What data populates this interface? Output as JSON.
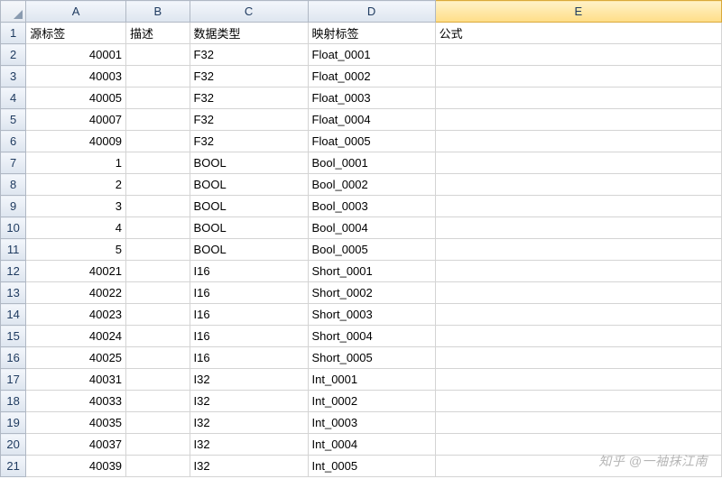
{
  "columns": [
    "A",
    "B",
    "C",
    "D",
    "E"
  ],
  "selected_column": "E",
  "headers": {
    "A": "源标签",
    "B": "描述",
    "C": "数据类型",
    "D": "映射标签",
    "E": "公式"
  },
  "rows": [
    {
      "n": 1,
      "A": "源标签",
      "B": "描述",
      "C": "数据类型",
      "D": "映射标签",
      "E": "公式"
    },
    {
      "n": 2,
      "A": "40001",
      "B": "",
      "C": "F32",
      "D": "Float_0001",
      "E": ""
    },
    {
      "n": 3,
      "A": "40003",
      "B": "",
      "C": "F32",
      "D": "Float_0002",
      "E": ""
    },
    {
      "n": 4,
      "A": "40005",
      "B": "",
      "C": "F32",
      "D": "Float_0003",
      "E": ""
    },
    {
      "n": 5,
      "A": "40007",
      "B": "",
      "C": "F32",
      "D": "Float_0004",
      "E": ""
    },
    {
      "n": 6,
      "A": "40009",
      "B": "",
      "C": "F32",
      "D": "Float_0005",
      "E": ""
    },
    {
      "n": 7,
      "A": "1",
      "B": "",
      "C": "BOOL",
      "D": "Bool_0001",
      "E": ""
    },
    {
      "n": 8,
      "A": "2",
      "B": "",
      "C": "BOOL",
      "D": "Bool_0002",
      "E": ""
    },
    {
      "n": 9,
      "A": "3",
      "B": "",
      "C": "BOOL",
      "D": "Bool_0003",
      "E": ""
    },
    {
      "n": 10,
      "A": "4",
      "B": "",
      "C": "BOOL",
      "D": "Bool_0004",
      "E": ""
    },
    {
      "n": 11,
      "A": "5",
      "B": "",
      "C": "BOOL",
      "D": "Bool_0005",
      "E": ""
    },
    {
      "n": 12,
      "A": "40021",
      "B": "",
      "C": "I16",
      "D": "Short_0001",
      "E": ""
    },
    {
      "n": 13,
      "A": "40022",
      "B": "",
      "C": "I16",
      "D": "Short_0002",
      "E": ""
    },
    {
      "n": 14,
      "A": "40023",
      "B": "",
      "C": "I16",
      "D": "Short_0003",
      "E": ""
    },
    {
      "n": 15,
      "A": "40024",
      "B": "",
      "C": "I16",
      "D": "Short_0004",
      "E": ""
    },
    {
      "n": 16,
      "A": "40025",
      "B": "",
      "C": "I16",
      "D": "Short_0005",
      "E": ""
    },
    {
      "n": 17,
      "A": "40031",
      "B": "",
      "C": "I32",
      "D": "Int_0001",
      "E": ""
    },
    {
      "n": 18,
      "A": "40033",
      "B": "",
      "C": "I32",
      "D": "Int_0002",
      "E": ""
    },
    {
      "n": 19,
      "A": "40035",
      "B": "",
      "C": "I32",
      "D": "Int_0003",
      "E": ""
    },
    {
      "n": 20,
      "A": "40037",
      "B": "",
      "C": "I32",
      "D": "Int_0004",
      "E": ""
    },
    {
      "n": 21,
      "A": "40039",
      "B": "",
      "C": "I32",
      "D": "Int_0005",
      "E": ""
    }
  ],
  "watermark": "知乎 @一袖抹江南"
}
